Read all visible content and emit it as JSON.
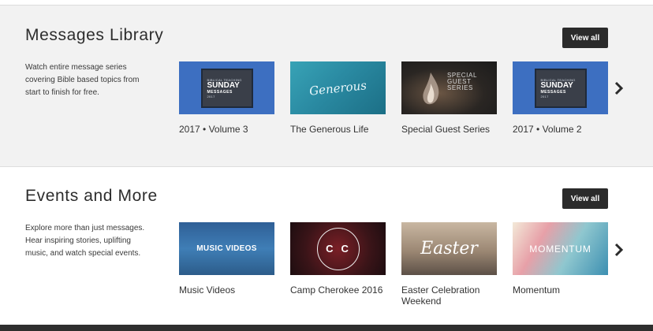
{
  "messages": {
    "title": "Messages Library",
    "description": "Watch entire message series covering Bible based topics from start to finish for free.",
    "view_all": "View all",
    "cards": [
      {
        "title": "2017 • Volume 3",
        "thumb": {
          "line1": "SUNDAY",
          "line2": "MESSAGES",
          "year": "2017"
        }
      },
      {
        "title": "The Generous Life",
        "thumb": {
          "text": "Generous"
        }
      },
      {
        "title": "Special Guest Series",
        "thumb": {
          "line1": "SPECIAL",
          "line2": "GUEST",
          "line3": "SERIES"
        }
      },
      {
        "title": "2017 • Volume 2",
        "thumb": {
          "line1": "SUNDAY",
          "line2": "MESSAGES",
          "year": "2017"
        }
      }
    ]
  },
  "events": {
    "title": "Events and More",
    "description": "Explore more than just messages. Hear inspiring stories, uplifting music, and watch special events.",
    "view_all": "View all",
    "cards": [
      {
        "title": "Music Videos",
        "thumb": {
          "text": "MUSIC VIDEOS"
        }
      },
      {
        "title": "Camp Cherokee 2016",
        "thumb": {
          "text": "CC"
        }
      },
      {
        "title": "Easter Celebration Weekend",
        "thumb": {
          "text": "Easter"
        }
      },
      {
        "title": "Momentum",
        "thumb": {
          "text": "MOMENTUM"
        }
      }
    ]
  },
  "icons": {
    "next": "chevron-right-icon"
  }
}
